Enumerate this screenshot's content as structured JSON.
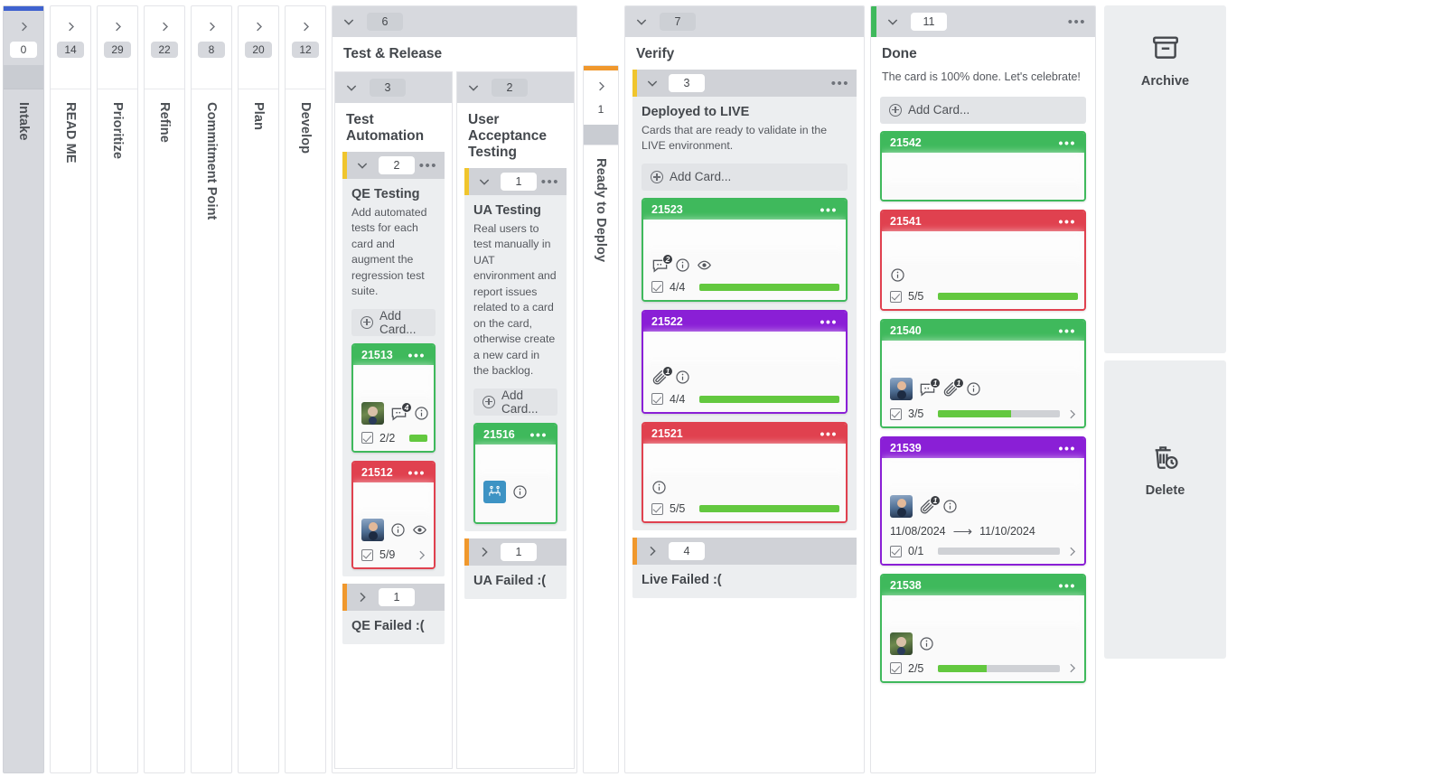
{
  "board": {
    "collapsed_lanes": [
      {
        "name": "Intake",
        "count": "0",
        "active": true,
        "top_color": "#3f62cf"
      },
      {
        "name": "READ ME",
        "count": "14",
        "active": false,
        "top_color": ""
      },
      {
        "name": "Prioritize",
        "count": "29",
        "active": false,
        "top_color": ""
      },
      {
        "name": "Refine",
        "count": "22",
        "active": false,
        "top_color": ""
      },
      {
        "name": "Commitment Point",
        "count": "8",
        "active": false,
        "top_color": ""
      },
      {
        "name": "Plan",
        "count": "20",
        "active": false,
        "top_color": ""
      },
      {
        "name": "Develop",
        "count": "12",
        "active": false,
        "top_color": ""
      }
    ],
    "ready_to_deploy": {
      "name": "Ready to Deploy",
      "count": "1",
      "top_color": "#f0982d"
    },
    "test_release": {
      "name": "Test & Release",
      "count": "6",
      "sublanes": [
        {
          "name": "Test Automation",
          "count": "3",
          "groups": [
            {
              "title": "QE Testing",
              "count": "2",
              "description": "Add automated tests for each card and augment the regression test suite.",
              "stripe": "#f0c52d",
              "add_card_label": "Add Card...",
              "cards": [
                {
                  "id": "21513",
                  "color": "#3fb95c",
                  "avatar": "green",
                  "comments": "4",
                  "has_info": true,
                  "has_watch": false,
                  "checklist": "2/2",
                  "progress": 100,
                  "has_expand": false
                },
                {
                  "id": "21512",
                  "color": "#e0414f",
                  "avatar": "blue",
                  "has_info": true,
                  "has_watch": true,
                  "checklist": "5/9",
                  "progress": 55,
                  "has_expand": true
                }
              ]
            }
          ],
          "collapsed_groups": [
            {
              "title": "QE Failed :(",
              "count": "1",
              "stripe": "#f0982d"
            }
          ]
        },
        {
          "name": "User Acceptance Testing",
          "count": "2",
          "groups": [
            {
              "title": "UA Testing",
              "count": "1",
              "description": "Real users to test manually in UAT environment and report issues related to a card on the card, otherwise create a new card in the backlog.",
              "stripe": "#f0c52d",
              "add_card_label": "Add Card...",
              "cards": [
                {
                  "id": "21516",
                  "color": "#3fb95c",
                  "avatar": "placeholder",
                  "has_info": true,
                  "has_watch": false,
                  "checklist": "",
                  "progress": 0,
                  "has_expand": false
                }
              ]
            }
          ],
          "collapsed_groups": [
            {
              "title": "UA Failed :(",
              "count": "1",
              "stripe": "#f0982d"
            }
          ]
        }
      ]
    },
    "verify": {
      "name": "Verify",
      "count": "7",
      "groups": [
        {
          "title": "Deployed to LIVE",
          "count": "3",
          "description": "Cards that are ready to validate in the LIVE environment.",
          "stripe": "#f0c52d",
          "add_card_label": "Add Card...",
          "cards": [
            {
              "id": "21523",
              "color": "#3fb95c",
              "comments": "2",
              "has_info": true,
              "has_watch": true,
              "checklist": "4/4",
              "progress": 100,
              "has_expand": false
            },
            {
              "id": "21522",
              "color": "#8a1fd6",
              "attachments": "1",
              "has_info": true,
              "has_watch": false,
              "checklist": "4/4",
              "progress": 100,
              "has_expand": false
            },
            {
              "id": "21521",
              "color": "#e0414f",
              "has_info": true,
              "has_watch": false,
              "checklist": "5/5",
              "progress": 100,
              "has_expand": false
            }
          ]
        }
      ],
      "collapsed_groups": [
        {
          "title": "Live Failed :(",
          "count": "4",
          "stripe": "#f0982d"
        }
      ]
    },
    "done": {
      "name": "Done",
      "count": "11",
      "description": "The card is 100% done. Let's celebrate!",
      "stripe": "#3fb95c",
      "add_card_label": "Add Card...",
      "cards": [
        {
          "id": "21542",
          "color": "#3fb95c",
          "has_info": false,
          "checklist": "",
          "progress": 0,
          "has_expand": false
        },
        {
          "id": "21541",
          "color": "#e0414f",
          "has_info": true,
          "checklist": "5/5",
          "progress": 100,
          "has_expand": false
        },
        {
          "id": "21540",
          "color": "#3fb95c",
          "avatar": "blue",
          "comments": "1",
          "attachments": "1",
          "has_info": true,
          "checklist": "3/5",
          "progress": 60,
          "has_expand": true
        },
        {
          "id": "21539",
          "color": "#8a1fd6",
          "avatar": "blue",
          "attachments": "1",
          "has_info": true,
          "date_start": "11/08/2024",
          "date_end": "11/10/2024",
          "checklist": "0/1",
          "progress": 0,
          "has_expand": true
        },
        {
          "id": "21538",
          "color": "#3fb95c",
          "avatar": "green",
          "has_info": true,
          "checklist": "2/5",
          "progress": 40,
          "has_expand": true
        }
      ]
    },
    "drop_panel": {
      "archive": {
        "label": "Archive",
        "icon": "archive-box-icon"
      },
      "delete": {
        "label": "Delete",
        "icon": "trash-clock-icon"
      }
    }
  }
}
